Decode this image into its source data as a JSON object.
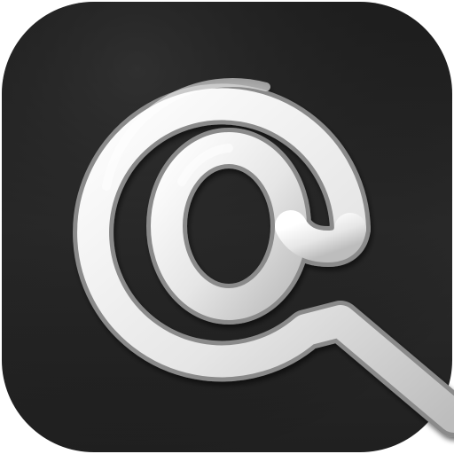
{
  "icon": {
    "name": "at-sign-icon",
    "tile_color": "#2a2a2a",
    "stroke_color_light": "#f3f3f3",
    "stroke_color_dark": "#bfbfbf",
    "edge_color": "#8a8a8a"
  }
}
